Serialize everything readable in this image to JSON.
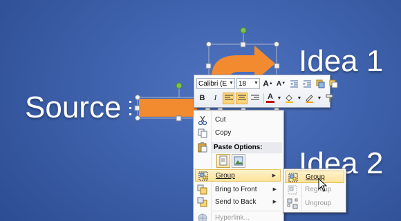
{
  "slide": {
    "source_text": "Source",
    "idea1_text": "Idea 1",
    "idea2_text": "Idea 2",
    "arrow_color": "#f28a30",
    "handle_color": "#7ec34a"
  },
  "mini_toolbar": {
    "font_name": "Calibri (E",
    "font_size": "18",
    "grow_font": "A",
    "shrink_font": "A",
    "bold": "B",
    "italic": "I",
    "font_color_glyph": "A",
    "font_color": "#c00000",
    "icons": [
      "decrease-indent-icon",
      "increase-indent-icon",
      "shape-styles-icon",
      "format-painter-icon",
      "align-left-icon",
      "center-icon",
      "align-right-icon",
      "shape-fill-icon",
      "shape-outline-icon",
      "eraser-icon"
    ]
  },
  "context_menu": {
    "cut_label": "Cut",
    "copy_label": "Copy",
    "paste_header": "Paste Options:",
    "group_label": "Group",
    "bring_front_label": "Bring to Front",
    "send_back_label": "Send to Back",
    "hyperlink_label": "Hyperlink..."
  },
  "submenu": {
    "group_label": "Group",
    "regroup_label": "Regroup",
    "ungroup_label": "Ungroup"
  }
}
